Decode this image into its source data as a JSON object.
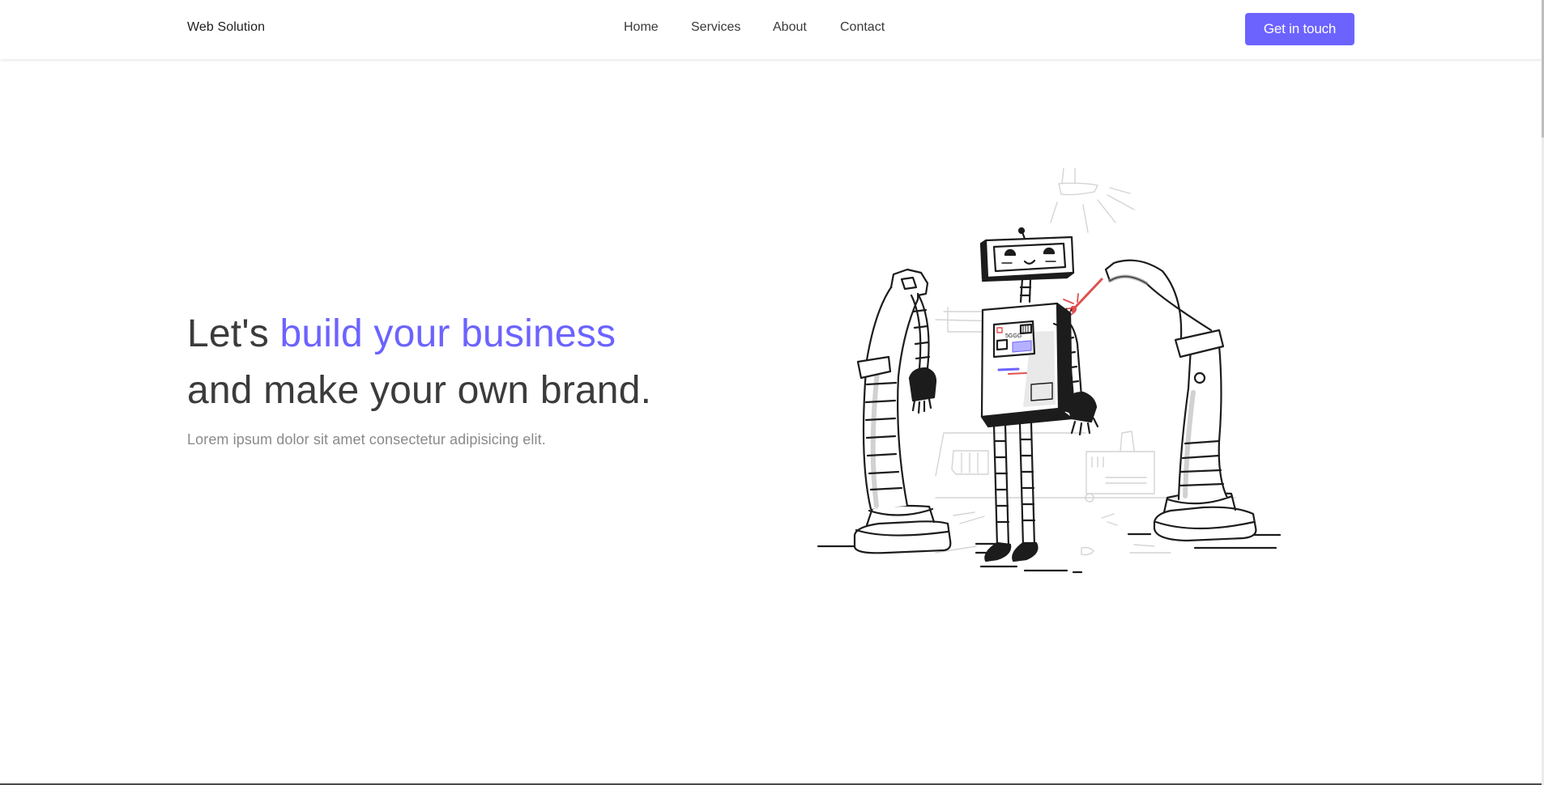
{
  "navbar": {
    "brand": "Web Solution",
    "links": [
      {
        "label": "Home"
      },
      {
        "label": "Services"
      },
      {
        "label": "About"
      },
      {
        "label": "Contact"
      }
    ],
    "cta_label": "Get in touch"
  },
  "hero": {
    "title_part1": "Let's ",
    "title_accent": "build your business",
    "title_part2": "and make your own brand.",
    "subtitle": "Lorem ipsum dolor sit amet consectetur adipisicing elit."
  },
  "illustration": {
    "chip_label": "5GGG"
  },
  "colors": {
    "accent": "#6c63ff",
    "spark": "#e05050",
    "text": "#3b3b3b",
    "muted": "#8a8a8a"
  }
}
